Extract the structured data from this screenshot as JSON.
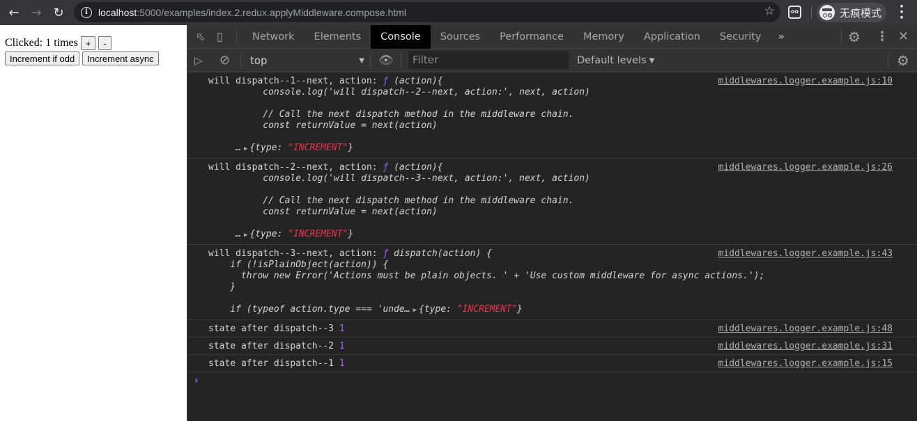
{
  "browser": {
    "url_host": "localhost",
    "url_path": ":5000/examples/index.2.redux.applyMiddleware.compose.html",
    "incognito_label": "无痕模式",
    "icons": {
      "back": "arrow-left-icon",
      "forward": "arrow-right-icon",
      "reload": "reload-icon",
      "info": "info-icon",
      "bookmark": "star-icon",
      "extension": "extension-icon",
      "incognito": "incognito-icon",
      "menu": "vertical-dots-icon"
    }
  },
  "page": {
    "clicked_prefix": "Clicked: ",
    "clicked_count": "1",
    "clicked_suffix": " times",
    "plus_label": "+",
    "minus_label": "-",
    "increment_odd_label": "Increment if odd",
    "increment_async_label": "Increment async"
  },
  "devtools": {
    "tabs": [
      {
        "label": "Network"
      },
      {
        "label": "Elements"
      },
      {
        "label": "Console",
        "active": true
      },
      {
        "label": "Sources"
      },
      {
        "label": "Performance"
      },
      {
        "label": "Memory"
      },
      {
        "label": "Application"
      },
      {
        "label": "Security"
      }
    ],
    "more_tabs": "»",
    "context": "top",
    "filter_placeholder": "Filter",
    "levels_label": "Default levels",
    "messages": [
      {
        "lines": [
          {
            "prefix": "will dispatch--1--next, action: ",
            "fkw": "ƒ",
            "code": " (action){"
          },
          {
            "code": "          console.log('will dispatch--2--next, action:', next, action)"
          },
          {
            "code": ""
          },
          {
            "code": "          // Call the next dispatch method in the middleware chain."
          },
          {
            "code": "          const returnValue = next(action)"
          },
          {
            "code": ""
          },
          {
            "code": "     …",
            "obj_key": "{type: ",
            "obj_val": "\"INCREMENT\"",
            "obj_end": "}"
          }
        ],
        "source": "middlewares.logger.example.js:10"
      },
      {
        "lines": [
          {
            "prefix": "will dispatch--2--next, action: ",
            "fkw": "ƒ",
            "code": " (action){"
          },
          {
            "code": "          console.log('will dispatch--3--next, action:', next, action)"
          },
          {
            "code": ""
          },
          {
            "code": "          // Call the next dispatch method in the middleware chain."
          },
          {
            "code": "          const returnValue = next(action)"
          },
          {
            "code": ""
          },
          {
            "code": "     …",
            "obj_key": "{type: ",
            "obj_val": "\"INCREMENT\"",
            "obj_end": "}"
          }
        ],
        "source": "middlewares.logger.example.js:26"
      },
      {
        "lines": [
          {
            "prefix": "will dispatch--3--next, action: ",
            "fkw": "ƒ",
            "code": " dispatch(action) {"
          },
          {
            "code": "    if (!isPlainObject(action)) {"
          },
          {
            "code": "      throw new Error('Actions must be plain objects. ' + 'Use custom middleware for async actions.');"
          },
          {
            "code": "    }"
          },
          {
            "code": ""
          },
          {
            "code": "    if (typeof action.type === 'unde…",
            "obj_key": "{type: ",
            "obj_val": "\"INCREMENT\"",
            "obj_end": "}"
          }
        ],
        "source": "middlewares.logger.example.js:43"
      },
      {
        "lines": [
          {
            "prefix": "state after dispatch--3 ",
            "num": "1"
          }
        ],
        "source": "middlewares.logger.example.js:48"
      },
      {
        "lines": [
          {
            "prefix": "state after dispatch--2 ",
            "num": "1"
          }
        ],
        "source": "middlewares.logger.example.js:31"
      },
      {
        "lines": [
          {
            "prefix": "state after dispatch--1 ",
            "num": "1"
          }
        ],
        "source": "middlewares.logger.example.js:15"
      }
    ],
    "prompt": "›"
  }
}
